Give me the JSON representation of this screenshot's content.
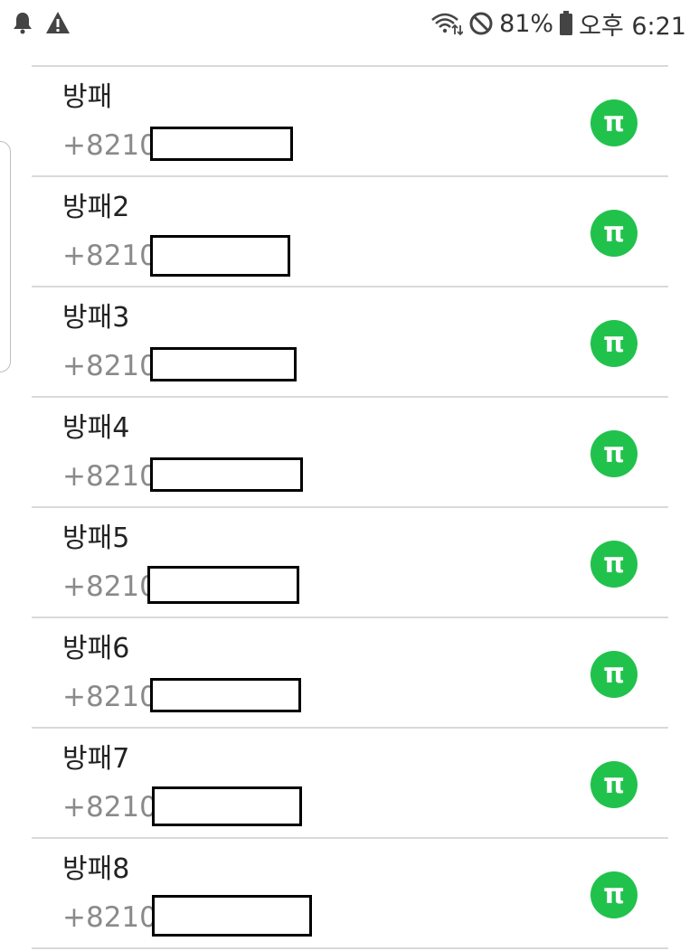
{
  "status_bar": {
    "left_icons": [
      "bell-icon",
      "warning-icon"
    ],
    "right_icons": [
      "wifi-icon",
      "do-not-disturb-icon",
      "battery-icon"
    ],
    "battery_text": "81%",
    "time_text": "오후 6:21"
  },
  "contacts": [
    {
      "name": "방패",
      "number": "+8210",
      "badge": "π",
      "badge_color": "#20c24c"
    },
    {
      "name": "방패2",
      "number": "+8210",
      "badge": "π",
      "badge_color": "#20c24c"
    },
    {
      "name": "방패3",
      "number": "+8210",
      "badge": "π",
      "badge_color": "#20c24c"
    },
    {
      "name": "방패4",
      "number": "+8210",
      "badge": "π",
      "badge_color": "#20c24c"
    },
    {
      "name": "방패5",
      "number": "+8210",
      "badge": "π",
      "badge_color": "#20c24c"
    },
    {
      "name": "방패6",
      "number": "+8210",
      "badge": "π",
      "badge_color": "#20c24c"
    },
    {
      "name": "방패7",
      "number": "+8210",
      "badge": "π",
      "badge_color": "#20c24c"
    },
    {
      "name": "방패8",
      "number": "+8210",
      "badge": "π",
      "badge_color": "#20c24c"
    }
  ]
}
